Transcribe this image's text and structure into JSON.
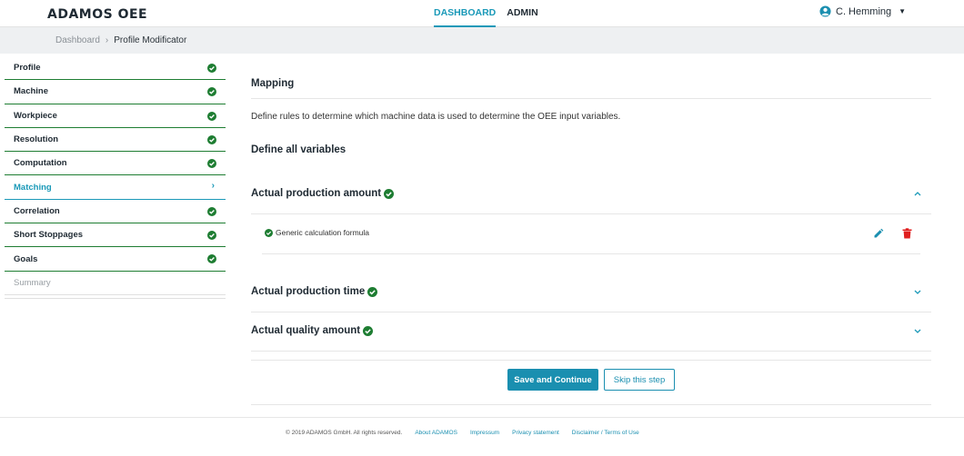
{
  "header": {
    "logo": "ADAMOS OEE",
    "nav": [
      "DASHBOARD",
      "ADMIN"
    ],
    "active_nav": "DASHBOARD",
    "user_name": "C. Hemming",
    "user_icon": "user-circle-icon"
  },
  "breadcrumb": {
    "home": "Dashboard",
    "current": "Profile Modificator"
  },
  "sidebar": {
    "steps": [
      {
        "label": "Profile",
        "status": "done"
      },
      {
        "label": "Machine",
        "status": "done"
      },
      {
        "label": "Workpiece",
        "status": "done"
      },
      {
        "label": "Resolution",
        "status": "done"
      },
      {
        "label": "Computation",
        "status": "done"
      },
      {
        "label": "Matching",
        "status": "active"
      },
      {
        "label": "Correlation",
        "status": "done"
      },
      {
        "label": "Short Stoppages",
        "status": "done"
      },
      {
        "label": "Goals",
        "status": "done"
      },
      {
        "label": "Summary",
        "status": "pending"
      }
    ]
  },
  "main": {
    "title": "Mapping",
    "description": "Define rules to determine which machine data is used to determine the OEE input variables.",
    "subtitle": "Define all variables",
    "sections": [
      {
        "title": "Actual production amount",
        "expanded": true,
        "rules": [
          {
            "label": "Generic calculation formula"
          }
        ]
      },
      {
        "title": "Actual production time",
        "expanded": false
      },
      {
        "title": "Actual quality amount",
        "expanded": false
      }
    ],
    "save_label": "Save and Continue",
    "skip_label": "Skip this step"
  },
  "footer": {
    "copyright": "© 2019 ADAMOS GmbH. All rights reserved.",
    "links": [
      "About ADAMOS",
      "Impressum",
      "Privacy statement",
      "Disclaimer / Terms of Use"
    ]
  },
  "colors": {
    "accent": "#1a99b8",
    "success": "#1e7d32",
    "danger": "#e02020"
  }
}
